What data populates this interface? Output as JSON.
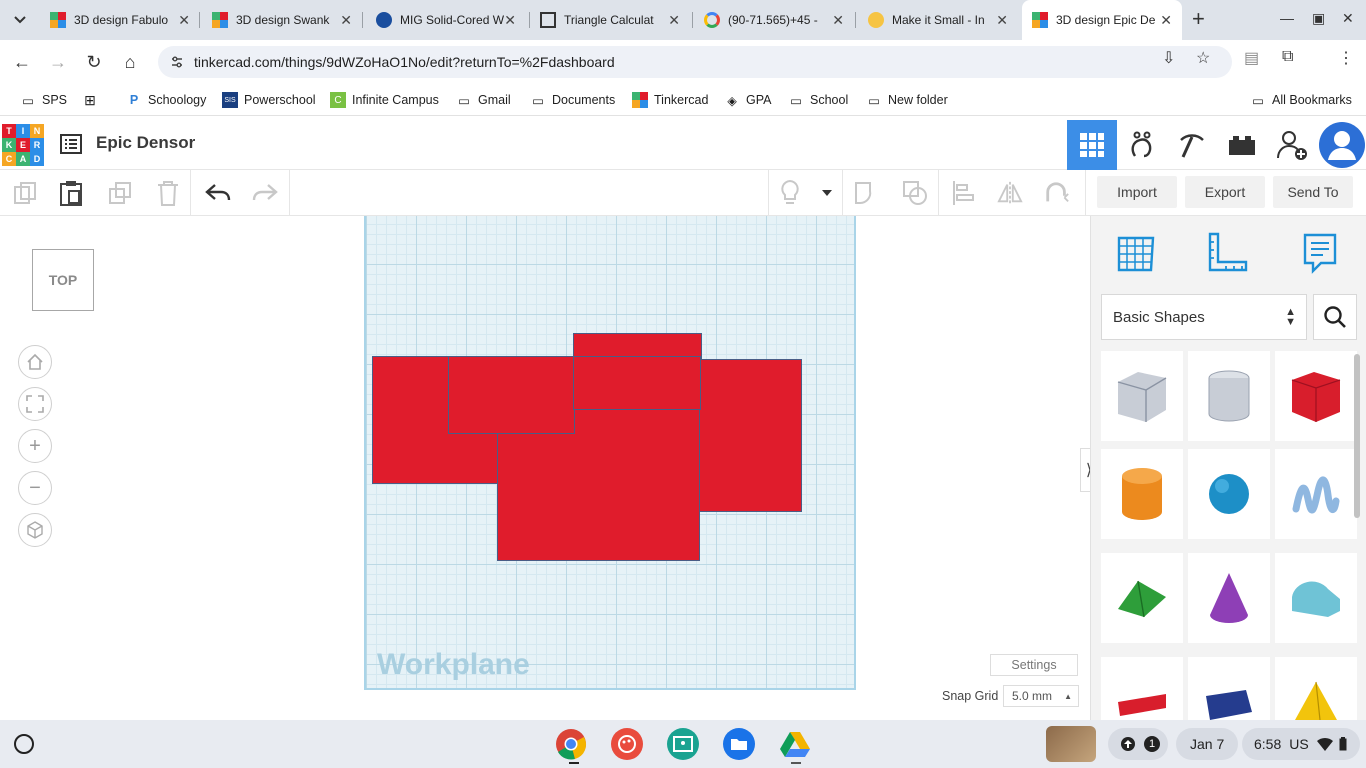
{
  "browser": {
    "tabs": [
      {
        "title": "3D design Fabulo",
        "active": false
      },
      {
        "title": "3D design Swank",
        "active": false
      },
      {
        "title": "MIG Solid-Cored W",
        "active": false
      },
      {
        "title": "Triangle Calculat",
        "active": false
      },
      {
        "title": "(90-71.565)+45 -",
        "active": false
      },
      {
        "title": "Make it Small - In",
        "active": false
      },
      {
        "title": "3D design Epic De",
        "active": true
      }
    ],
    "url": "tinkercad.com/things/9dWZoHaO1No/edit?returnTo=%2Fdashboard",
    "bookmarks": [
      "SPS",
      "Schoology",
      "Powerschool",
      "Infinite Campus",
      "Gmail",
      "Documents",
      "Tinkercad",
      "GPA",
      "School",
      "New folder"
    ],
    "all_bookmarks": "All Bookmarks"
  },
  "app": {
    "logo_letters": [
      "T",
      "I",
      "N",
      "K",
      "E",
      "R",
      "C",
      "A",
      "D"
    ],
    "design_name": "Epic Densor"
  },
  "toolbar": {
    "import": "Import",
    "export": "Export",
    "send_to": "Send To"
  },
  "canvas": {
    "viewcube_label": "TOP",
    "workplane_label": "Workplane",
    "settings": "Settings",
    "snap_grid_label": "Snap Grid",
    "snap_grid_value": "5.0 mm"
  },
  "panel": {
    "category": "Basic Shapes",
    "shapes": [
      "box-striped",
      "cylinder-striped",
      "box",
      "cylinder",
      "sphere",
      "scribble",
      "roof",
      "cone",
      "round-roof",
      "text",
      "wedge",
      "pyramid"
    ]
  },
  "shelf": {
    "notification_count": "1",
    "date": "Jan 7",
    "time": "6:58",
    "locale": "US"
  },
  "colors": {
    "accent": "#3c8ee7",
    "shape_red": "#e01c2c",
    "workplane": "#e6f2f7"
  }
}
